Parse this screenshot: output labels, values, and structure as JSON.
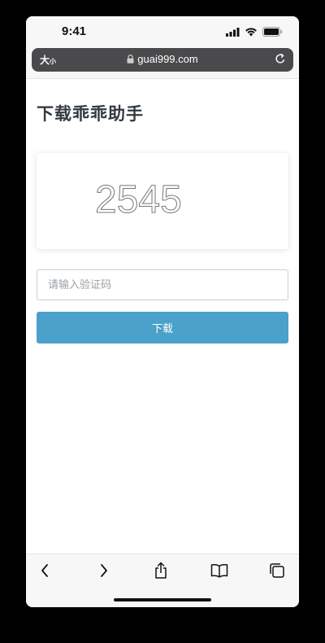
{
  "status_bar": {
    "time": "9:41"
  },
  "address_bar": {
    "text_size_label": "大",
    "text_size_small": "小",
    "url": "guai999.com"
  },
  "page": {
    "title": "下载乖乖助手",
    "captcha_value": "2545",
    "code_input_placeholder": "请输入验证码",
    "code_input_value": "",
    "download_label": "下载"
  },
  "toolbar": {
    "icons": [
      "back-icon",
      "forward-icon",
      "share-icon",
      "bookmarks-icon",
      "tabs-icon"
    ]
  },
  "colors": {
    "accent": "#4aa1c9",
    "title": "#333a40",
    "address_bar": "#4a4a4c"
  }
}
